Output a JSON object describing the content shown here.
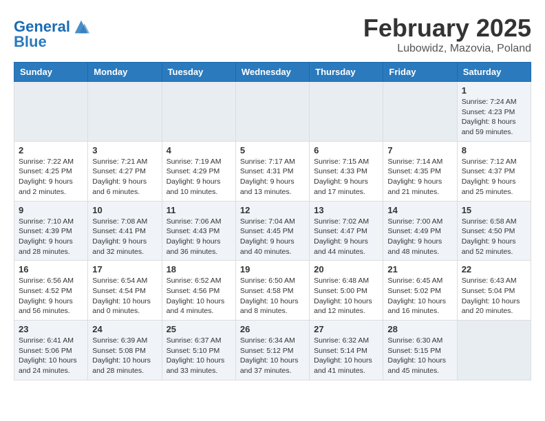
{
  "header": {
    "logo_line1": "General",
    "logo_line2": "Blue",
    "title": "February 2025",
    "subtitle": "Lubowidz, Mazovia, Poland"
  },
  "days_of_week": [
    "Sunday",
    "Monday",
    "Tuesday",
    "Wednesday",
    "Thursday",
    "Friday",
    "Saturday"
  ],
  "weeks": [
    [
      {
        "day": "",
        "info": ""
      },
      {
        "day": "",
        "info": ""
      },
      {
        "day": "",
        "info": ""
      },
      {
        "day": "",
        "info": ""
      },
      {
        "day": "",
        "info": ""
      },
      {
        "day": "",
        "info": ""
      },
      {
        "day": "1",
        "info": "Sunrise: 7:24 AM\nSunset: 4:23 PM\nDaylight: 8 hours and 59 minutes."
      }
    ],
    [
      {
        "day": "2",
        "info": "Sunrise: 7:22 AM\nSunset: 4:25 PM\nDaylight: 9 hours and 2 minutes."
      },
      {
        "day": "3",
        "info": "Sunrise: 7:21 AM\nSunset: 4:27 PM\nDaylight: 9 hours and 6 minutes."
      },
      {
        "day": "4",
        "info": "Sunrise: 7:19 AM\nSunset: 4:29 PM\nDaylight: 9 hours and 10 minutes."
      },
      {
        "day": "5",
        "info": "Sunrise: 7:17 AM\nSunset: 4:31 PM\nDaylight: 9 hours and 13 minutes."
      },
      {
        "day": "6",
        "info": "Sunrise: 7:15 AM\nSunset: 4:33 PM\nDaylight: 9 hours and 17 minutes."
      },
      {
        "day": "7",
        "info": "Sunrise: 7:14 AM\nSunset: 4:35 PM\nDaylight: 9 hours and 21 minutes."
      },
      {
        "day": "8",
        "info": "Sunrise: 7:12 AM\nSunset: 4:37 PM\nDaylight: 9 hours and 25 minutes."
      }
    ],
    [
      {
        "day": "9",
        "info": "Sunrise: 7:10 AM\nSunset: 4:39 PM\nDaylight: 9 hours and 28 minutes."
      },
      {
        "day": "10",
        "info": "Sunrise: 7:08 AM\nSunset: 4:41 PM\nDaylight: 9 hours and 32 minutes."
      },
      {
        "day": "11",
        "info": "Sunrise: 7:06 AM\nSunset: 4:43 PM\nDaylight: 9 hours and 36 minutes."
      },
      {
        "day": "12",
        "info": "Sunrise: 7:04 AM\nSunset: 4:45 PM\nDaylight: 9 hours and 40 minutes."
      },
      {
        "day": "13",
        "info": "Sunrise: 7:02 AM\nSunset: 4:47 PM\nDaylight: 9 hours and 44 minutes."
      },
      {
        "day": "14",
        "info": "Sunrise: 7:00 AM\nSunset: 4:49 PM\nDaylight: 9 hours and 48 minutes."
      },
      {
        "day": "15",
        "info": "Sunrise: 6:58 AM\nSunset: 4:50 PM\nDaylight: 9 hours and 52 minutes."
      }
    ],
    [
      {
        "day": "16",
        "info": "Sunrise: 6:56 AM\nSunset: 4:52 PM\nDaylight: 9 hours and 56 minutes."
      },
      {
        "day": "17",
        "info": "Sunrise: 6:54 AM\nSunset: 4:54 PM\nDaylight: 10 hours and 0 minutes."
      },
      {
        "day": "18",
        "info": "Sunrise: 6:52 AM\nSunset: 4:56 PM\nDaylight: 10 hours and 4 minutes."
      },
      {
        "day": "19",
        "info": "Sunrise: 6:50 AM\nSunset: 4:58 PM\nDaylight: 10 hours and 8 minutes."
      },
      {
        "day": "20",
        "info": "Sunrise: 6:48 AM\nSunset: 5:00 PM\nDaylight: 10 hours and 12 minutes."
      },
      {
        "day": "21",
        "info": "Sunrise: 6:45 AM\nSunset: 5:02 PM\nDaylight: 10 hours and 16 minutes."
      },
      {
        "day": "22",
        "info": "Sunrise: 6:43 AM\nSunset: 5:04 PM\nDaylight: 10 hours and 20 minutes."
      }
    ],
    [
      {
        "day": "23",
        "info": "Sunrise: 6:41 AM\nSunset: 5:06 PM\nDaylight: 10 hours and 24 minutes."
      },
      {
        "day": "24",
        "info": "Sunrise: 6:39 AM\nSunset: 5:08 PM\nDaylight: 10 hours and 28 minutes."
      },
      {
        "day": "25",
        "info": "Sunrise: 6:37 AM\nSunset: 5:10 PM\nDaylight: 10 hours and 33 minutes."
      },
      {
        "day": "26",
        "info": "Sunrise: 6:34 AM\nSunset: 5:12 PM\nDaylight: 10 hours and 37 minutes."
      },
      {
        "day": "27",
        "info": "Sunrise: 6:32 AM\nSunset: 5:14 PM\nDaylight: 10 hours and 41 minutes."
      },
      {
        "day": "28",
        "info": "Sunrise: 6:30 AM\nSunset: 5:15 PM\nDaylight: 10 hours and 45 minutes."
      },
      {
        "day": "",
        "info": ""
      }
    ]
  ]
}
